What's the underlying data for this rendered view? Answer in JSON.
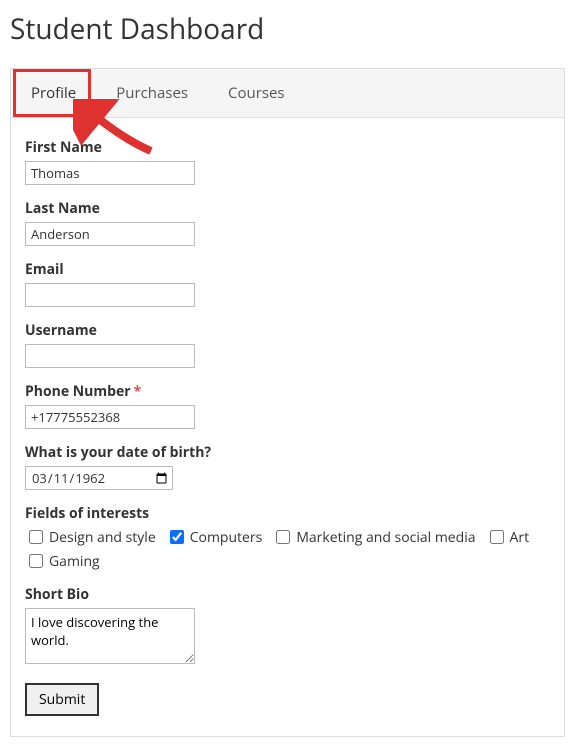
{
  "page_title": "Student Dashboard",
  "tabs": {
    "profile": "Profile",
    "purchases": "Purchases",
    "courses": "Courses"
  },
  "labels": {
    "first_name": "First Name",
    "last_name": "Last Name",
    "email": "Email",
    "username": "Username",
    "phone": "Phone Number",
    "dob": "What is your date of birth?",
    "interests": "Fields of interests",
    "bio": "Short Bio"
  },
  "values": {
    "first_name": "Thomas",
    "last_name": "Anderson",
    "email": "",
    "username": "",
    "phone": "+17775552368",
    "dob": "1962-03-11",
    "bio": "I love discovering the world."
  },
  "interests": [
    {
      "label": "Design and style",
      "checked": false
    },
    {
      "label": "Computers",
      "checked": true
    },
    {
      "label": "Marketing and social media",
      "checked": false
    },
    {
      "label": "Art",
      "checked": false
    },
    {
      "label": "Gaming",
      "checked": false
    }
  ],
  "required_mark": "*",
  "submit_label": "Submit"
}
